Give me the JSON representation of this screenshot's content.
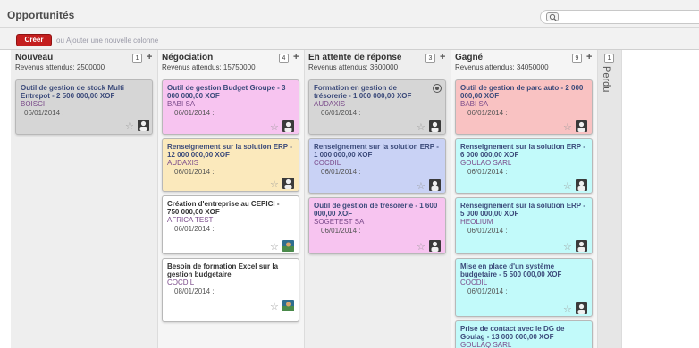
{
  "header": {
    "title": "Opportunités",
    "search_value": "",
    "search_icon": "search-icon"
  },
  "toolbar": {
    "create_label": "Créer",
    "or_label": "ou",
    "add_column_label": "Ajouter une nouvelle colonne"
  },
  "colors": {
    "create_button": "#c41e1e",
    "card_gray": "#d6d6d6",
    "card_pink": "#f7c4f0",
    "card_yellow": "#fbe9bc",
    "card_white": "#ffffff",
    "card_blue": "#c9d2f5",
    "card_red": "#f9c2c2",
    "card_cyan": "#c2fafa"
  },
  "columns": [
    {
      "title": "Nouveau",
      "expected": "Revenus attendus: 2500000",
      "count": "1",
      "cards": [
        {
          "title": "Outil de gestion de stock Multi Entrepot - 2 500 000,00 XOF",
          "company": "BOISCI",
          "date": "06/01/2014 :",
          "color": "gray",
          "avatar": "person"
        }
      ]
    },
    {
      "title": "Négociation",
      "expected": "Revenus attendus: 15750000",
      "count": "4",
      "cards": [
        {
          "title": "Outil de gestion Budget Groupe - 3 000 000,00 XOF",
          "company": "BABI SA",
          "date": "06/01/2014 :",
          "color": "pink",
          "avatar": "person"
        },
        {
          "title": "Renseignement sur la solution ERP - 12 000 000,00 XOF",
          "company": "AUDAXIS",
          "date": "06/01/2014 :",
          "color": "yellow",
          "avatar": "person"
        },
        {
          "title": "Création d'entreprise au CEPICI - 750 000,00 XOF",
          "company": "AFRICA TEST",
          "date": "06/01/2014 :",
          "color": "white",
          "avatar": "photo"
        },
        {
          "title": "Besoin de formation Excel sur la gestion budgetaire",
          "company": "COCDIL",
          "date": "08/01/2014 :",
          "color": "white",
          "avatar": "photo"
        }
      ]
    },
    {
      "title": "En attente de réponse",
      "expected": "Revenus attendus: 3600000",
      "count": "3",
      "cards": [
        {
          "title": "Formation en gestion de trésorerie - 1 000 000,00 XOF",
          "company": "AUDAXIS",
          "date": "06/01/2014 :",
          "color": "gray",
          "avatar": "person"
        },
        {
          "title": "Renseignement sur la solution ERP - 1 000 000,00 XOF",
          "company": "COCDIL",
          "date": "06/01/2014 :",
          "color": "blue",
          "avatar": "person"
        },
        {
          "title": "Outil de gestion de trésorerie - 1 600 000,00 XOF",
          "company": "SOGETEST SA",
          "date": "06/01/2014 :",
          "color": "pink",
          "avatar": "person"
        }
      ]
    },
    {
      "title": "Gagné",
      "expected": "Revenus attendus: 34050000",
      "count": "9",
      "cards": [
        {
          "title": "Outil de gestion de parc auto - 2 000 000,00 XOF",
          "company": "BABI SA",
          "date": "06/01/2014 :",
          "color": "red",
          "avatar": "person"
        },
        {
          "title": "Renseignement sur la solution ERP - 6 000 000,00 XOF",
          "company": "GOULAO SARL",
          "date": "06/01/2014 :",
          "color": "cyan",
          "avatar": "person"
        },
        {
          "title": "Renseignement sur la solution ERP - 5 000 000,00 XOF",
          "company": "HEOLIUM",
          "date": "06/01/2014 :",
          "color": "cyan",
          "avatar": "person"
        },
        {
          "title": "Mise en place d'un système budgetaire - 5 500 000,00 XOF",
          "company": "COCDIL",
          "date": "06/01/2014 :",
          "color": "cyan",
          "avatar": "person"
        },
        {
          "title": "Prise de contact avec le DG de Goulag - 13 000 000,00 XOF",
          "company": "GOULAQ SARL",
          "date": "",
          "color": "cyan",
          "avatar": "none"
        }
      ]
    },
    {
      "title": "Perdu",
      "count": "1"
    }
  ]
}
